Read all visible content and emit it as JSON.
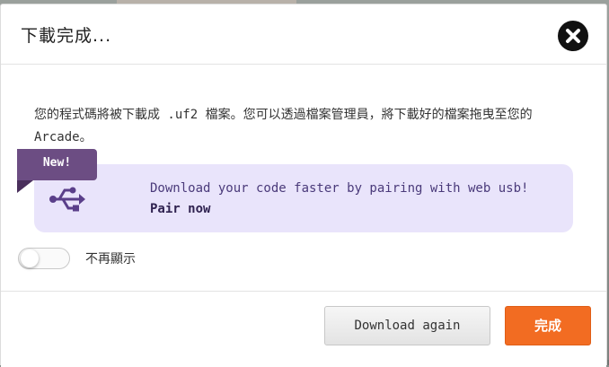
{
  "dialog": {
    "title": "下載完成...",
    "message": "您的程式碼將被下載成 .uf2 檔案。您可以透過檔案管理員，將下載好的檔案拖曳至您的 Arcade。",
    "close_icon": "close-icon"
  },
  "promo": {
    "badge": "New!",
    "icon": "usb-icon",
    "text": "Download your code faster by pairing with web usb!",
    "link": "Pair now",
    "colors": {
      "box_bg": "#e9e4fb",
      "badge_bg": "#6c4d83",
      "text": "#4a3a7a"
    }
  },
  "toggle": {
    "label": "不再顯示",
    "checked": false
  },
  "footer": {
    "secondary_label": "Download again",
    "primary_label": "完成",
    "primary_color": "#f26c22"
  }
}
